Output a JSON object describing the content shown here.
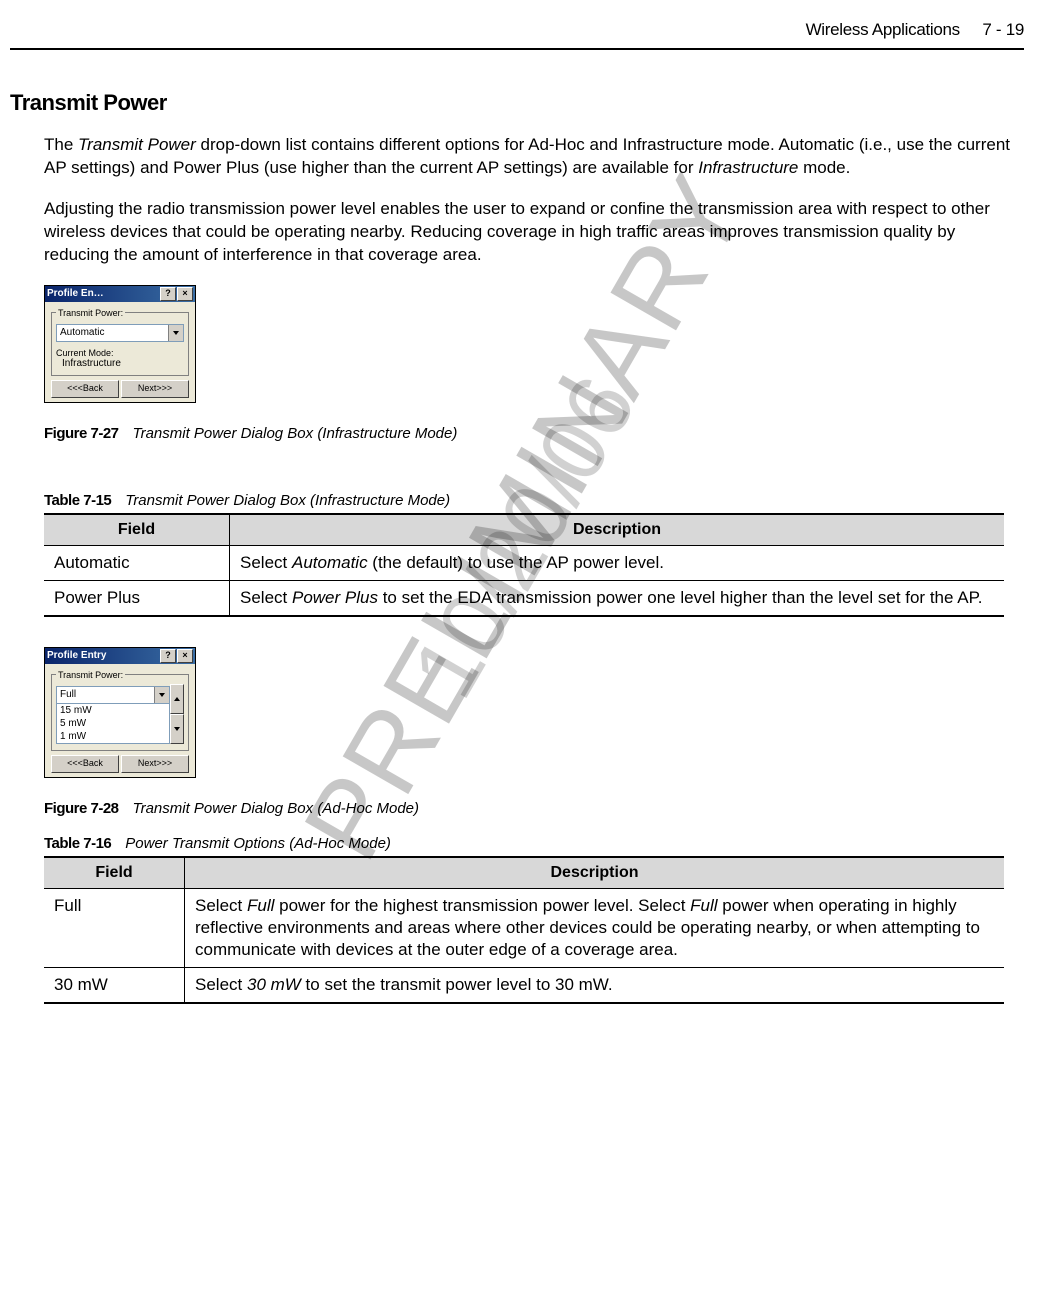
{
  "header": {
    "chapter_name": "Wireless Applications",
    "page_ref": "7 - 19"
  },
  "section_title": "Transmit Power",
  "para1_a": "The ",
  "para1_b": "Transmit Power",
  "para1_c": " drop-down list contains different options for Ad-Hoc and Infrastructure mode. Automatic (i.e., use the current AP settings) and Power Plus (use higher than the current AP settings) are available for ",
  "para1_d": "Infrastructure",
  "para1_e": " mode.",
  "para2": "Adjusting the radio transmission power level enables the user to expand or confine the transmission area with respect to other wireless devices that could be operating nearby. Reducing coverage in high traffic areas improves transmission quality by reducing the amount of interference in that coverage area.",
  "dialog1": {
    "title": "Profile En…",
    "help": "?",
    "close": "×",
    "legend": "Transmit Power:",
    "dropdown_value": "Automatic",
    "mode_label": "Current Mode:",
    "mode_value": "Infrastructure",
    "back": "<<<Back",
    "next": "Next>>>"
  },
  "fig27_label": "Figure 7-27",
  "fig27_text": "Transmit Power Dialog Box (Infrastructure Mode)",
  "tbl15_label": "Table 7-15",
  "tbl15_text": "Transmit Power Dialog Box (Infrastructure Mode)",
  "table15_head_field": "Field",
  "table15_head_desc": "Description",
  "table15": {
    "r1_field": "Automatic",
    "r1_desc_a": "Select ",
    "r1_desc_b": "Automatic",
    "r1_desc_c": " (the default) to use the AP power level.",
    "r2_field": "Power Plus",
    "r2_desc_a": "Select ",
    "r2_desc_b": "Power Plus",
    "r2_desc_c": " to set the EDA transmission power one level higher than the level set for the AP."
  },
  "dialog2": {
    "title": "Profile Entry",
    "help": "?",
    "close": "×",
    "legend": "Transmit Power:",
    "selected": "Full",
    "opt1": "15 mW",
    "opt2": "5 mW",
    "opt3": "1 mW",
    "back": "<<<Back",
    "next": "Next>>>"
  },
  "fig28_label": "Figure 7-28",
  "fig28_text": "Transmit Power Dialog Box (Ad-Hoc Mode)",
  "tbl16_label": "Table 7-16",
  "tbl16_text": "Power Transmit Options (Ad-Hoc Mode)",
  "table16_head_field": "Field",
  "table16_head_desc": "Description",
  "table16": {
    "r1_field": "Full",
    "r1_desc_a": "Select ",
    "r1_desc_b": "Full",
    "r1_desc_c": " power for the highest transmission power level. Select ",
    "r1_desc_d": "Full",
    "r1_desc_e": " power when operating in highly reflective environments and areas where other devices could be operating nearby, or when attempting to communicate with devices at the outer edge of a coverage area.",
    "r2_field": "30 mW",
    "r2_desc_a": "Select ",
    "r2_desc_b": "30 mW",
    "r2_desc_c": " to set the transmit power level to 30 mW."
  },
  "watermark1": "PRELIMINARY",
  "watermark2": "10/20/06"
}
